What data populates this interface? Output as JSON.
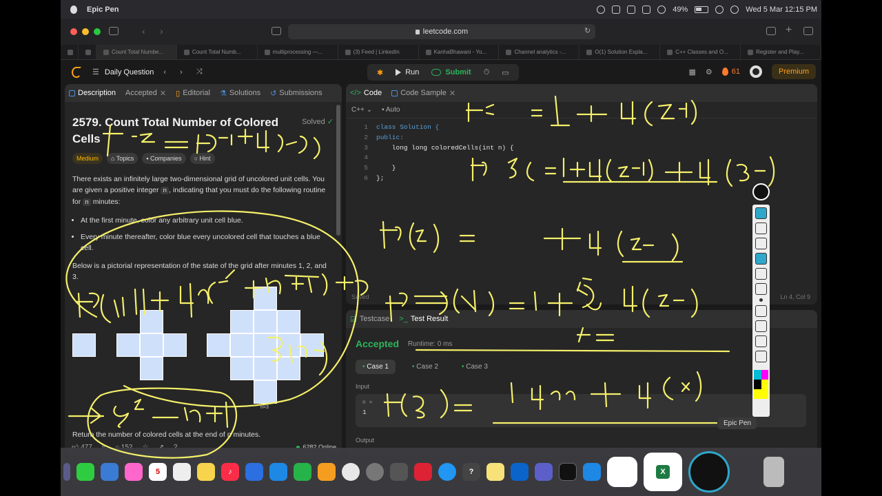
{
  "menubar": {
    "app_name": "Epic Pen",
    "battery": "49%",
    "datetime": "Wed 5 Mar  12:15 PM"
  },
  "browser": {
    "url": "leetcode.com",
    "tabs": [
      "Count Total Numbe...",
      "Count Total Numb...",
      "multiprocessing —...",
      "(3) Feed | LinkedIn",
      "KanhaBhawani - Yo...",
      "Channel analytics -...",
      "O(1) Solution Expla...",
      "C++ Classes and O...",
      "Register and Play..."
    ]
  },
  "leetcode": {
    "daily_question": "Daily Question",
    "run": "Run",
    "submit": "Submit",
    "streak": "61",
    "premium": "Premium"
  },
  "left_tabs": [
    "Description",
    "Accepted",
    "Editorial",
    "Solutions",
    "Submissions"
  ],
  "problem": {
    "title": "2579. Count Total Number of Colored Cells",
    "solved": "Solved",
    "difficulty": "Medium",
    "topics": "Topics",
    "companies": "Companies",
    "hint": "Hint",
    "p1_a": "There exists an infinitely large two-dimensional grid of uncolored unit cells. You are given a positive integer ",
    "p1_code": "n",
    "p1_b": ", indicating that you must do the following routine for ",
    "p1_code2": "n",
    "p1_c": " minutes:",
    "li1": "At the first minute, color any arbitrary unit cell blue.",
    "li2": "Every minute thereafter, color blue every uncolored cell that touches a blue cell.",
    "p2": "Below is a pictorial representation of the state of the grid after minutes 1, 2, and 3.",
    "minute_label": "n=3",
    "return_text": "Return the number of colored cells at the end of n minutes.",
    "likes": "477",
    "comments": "152",
    "online": "6282 Online"
  },
  "code_panel": {
    "tabs": [
      "Code",
      "Code Sample"
    ],
    "language": "C++",
    "mode": "Auto",
    "lines": [
      {
        "n": "1",
        "text": "class Solution {"
      },
      {
        "n": "2",
        "text": "public:"
      },
      {
        "n": "3",
        "text": "    long long coloredCells(int n) {"
      },
      {
        "n": "4",
        "text": ""
      },
      {
        "n": "5",
        "text": "    }"
      },
      {
        "n": "6",
        "text": "};"
      }
    ],
    "saved": "Saved",
    "position": "Ln 4, Col 9"
  },
  "test_panel": {
    "tabs": [
      "Testcase",
      "Test Result"
    ],
    "status": "Accepted",
    "runtime": "Runtime: 0 ms",
    "cases": [
      "Case 1",
      "Case 2",
      "Case 3"
    ],
    "input_label": "Input",
    "input_key": "n =",
    "input_value": "1",
    "output_label": "Output"
  },
  "epic_pen": {
    "label": "Epic Pen"
  },
  "colors": {
    "accent": "#ffa116",
    "success": "#2db55d",
    "ink": "#f5f06a",
    "cell": "#cfe0fb"
  }
}
